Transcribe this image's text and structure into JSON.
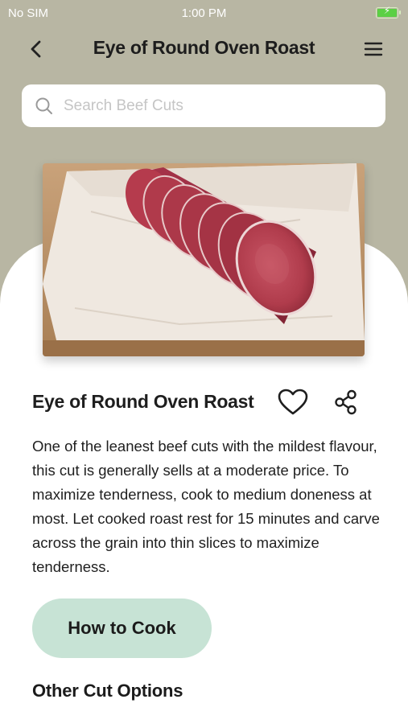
{
  "status_bar": {
    "carrier": "No SIM",
    "time": "1:00 PM",
    "battery_charging": true,
    "battery_level": 1.0
  },
  "nav": {
    "title": "Eye of Round Oven Roast",
    "back_icon": "chevron-left-icon",
    "menu_icon": "hamburger-menu-icon"
  },
  "search": {
    "placeholder": "Search Beef Cuts",
    "value": ""
  },
  "hero": {
    "image": "sliced-beef-roast-photo"
  },
  "detail": {
    "title": "Eye of Round Oven Roast",
    "favorite_icon": "heart-icon",
    "share_icon": "share-icon",
    "description": "One of the leanest beef cuts with the mildest flavour, this cut is generally sells at a moderate price. To maximize tenderness, cook to medium doneness at most. Let cooked roast rest for 15 minutes and carve across the grain into thin slices to maximize tenderness."
  },
  "actions": {
    "how_to_cook_label": "How to Cook"
  },
  "sections": {
    "other_options_title": "Other Cut Options"
  },
  "colors": {
    "header_bg": "#b8b6a3",
    "button_bg": "#c7e3d5",
    "text": "#1e1e1e"
  }
}
